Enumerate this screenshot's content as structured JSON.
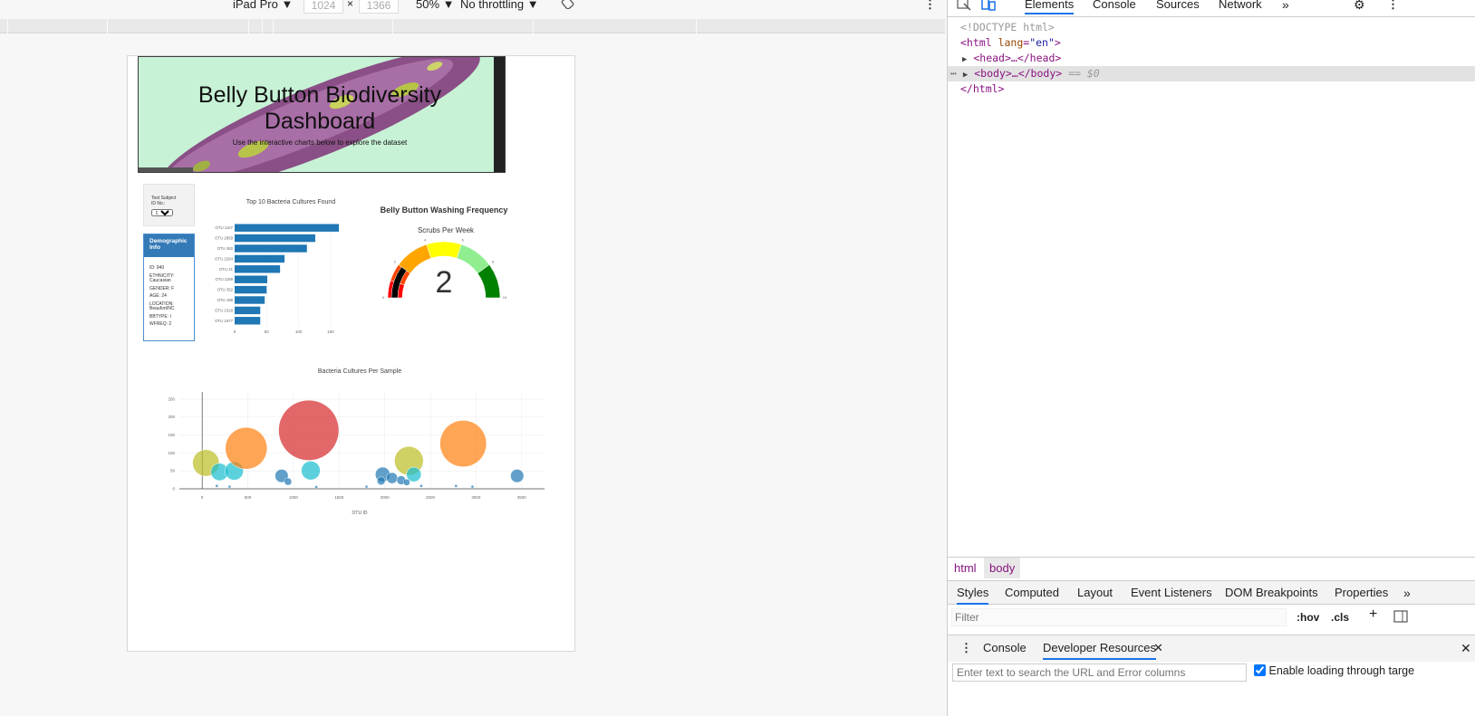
{
  "emulation_toolbar": {
    "device": "iPad Pro ▼",
    "width": "1024",
    "times": "×",
    "height": "1366",
    "zoom": "50% ▼",
    "throttling": "No throttling ▼"
  },
  "dashboard": {
    "title_line1": "Belly Button Biodiversity",
    "title_line2": "Dashboard",
    "subtitle": "Use the interactive charts below to explore the dataset",
    "select_label_1": "Test Subject",
    "select_label_2": "ID No.:",
    "select_value": "940",
    "demo_header": "Demographic Info",
    "demo": {
      "id": "ID: 940",
      "ethnicity": "ETHNICITY: Caucasian",
      "gender": "GENDER: F",
      "age": "AGE: 24",
      "location": "LOCATION: Beaufort/NC",
      "bbtype": "BBTYPE: I",
      "wfreq": "WFREQ: 2"
    }
  },
  "chart_data": [
    {
      "type": "bar",
      "orientation": "horizontal",
      "title": "Top 10 Bacteria Cultures Found",
      "categories": [
        "OTU 1167",
        "OTU 2859",
        "OTU 482",
        "OTU 2264",
        "OTU 41",
        "OTU 1189",
        "OTU 352",
        "OTU 189",
        "OTU 2318",
        "OTU 1977"
      ],
      "values": [
        163,
        126,
        113,
        78,
        71,
        51,
        50,
        47,
        40,
        40
      ],
      "xticks": [
        "0",
        "50",
        "100",
        "150"
      ],
      "xlim": [
        0,
        170
      ]
    },
    {
      "type": "gauge",
      "title": "Belly Button Washing Frequency",
      "subtitle": "Scrubs Per Week",
      "value": 2,
      "value_label": "2",
      "range": [
        0,
        10
      ],
      "tick_labels": [
        "0",
        "2",
        "4",
        "6",
        "8",
        "10"
      ],
      "bands": [
        {
          "from": 0,
          "to": 1,
          "color": "#ff0000"
        },
        {
          "from": 1,
          "to": 2,
          "color": "#ff4500"
        },
        {
          "from": 2,
          "to": 4,
          "color": "#ffa500"
        },
        {
          "from": 4,
          "to": 6,
          "color": "#ffff00"
        },
        {
          "from": 6,
          "to": 8,
          "color": "#90ee90"
        },
        {
          "from": 8,
          "to": 10,
          "color": "#008000"
        }
      ],
      "bar_color": "#000000"
    },
    {
      "type": "scatter",
      "title": "Bacteria Cultures Per Sample",
      "xlabel": "OTU ID",
      "xticks": [
        "0",
        "500",
        "1000",
        "1500",
        "2000",
        "2500",
        "3000",
        "3500"
      ],
      "yticks": [
        "0",
        "50",
        "100",
        "150",
        "200",
        "250"
      ],
      "xlim": [
        -250,
        3750
      ],
      "ylim": [
        0,
        270
      ],
      "points": [
        {
          "x": 40,
          "y": 72,
          "size": 72,
          "color": "#bcbd22"
        },
        {
          "x": 190,
          "y": 47,
          "size": 47,
          "color": "#17becf"
        },
        {
          "x": 350,
          "y": 50,
          "size": 50,
          "color": "#17becf"
        },
        {
          "x": 482,
          "y": 113,
          "size": 113,
          "color": "#ff7f0e"
        },
        {
          "x": 870,
          "y": 36,
          "size": 36,
          "color": "#1f77b4"
        },
        {
          "x": 940,
          "y": 20,
          "size": 20,
          "color": "#1f77b4"
        },
        {
          "x": 1167,
          "y": 163,
          "size": 163,
          "color": "#d62728"
        },
        {
          "x": 1189,
          "y": 51,
          "size": 51,
          "color": "#17becf"
        },
        {
          "x": 1977,
          "y": 40,
          "size": 40,
          "color": "#1f77b4"
        },
        {
          "x": 1960,
          "y": 22,
          "size": 22,
          "color": "#1f77b4"
        },
        {
          "x": 2080,
          "y": 30,
          "size": 30,
          "color": "#1f77b4"
        },
        {
          "x": 2180,
          "y": 24,
          "size": 24,
          "color": "#1f77b4"
        },
        {
          "x": 2264,
          "y": 78,
          "size": 78,
          "color": "#bcbd22"
        },
        {
          "x": 2318,
          "y": 40,
          "size": 40,
          "color": "#17becf"
        },
        {
          "x": 2240,
          "y": 18,
          "size": 18,
          "color": "#1f77b4"
        },
        {
          "x": 2859,
          "y": 126,
          "size": 126,
          "color": "#ff7f0e"
        },
        {
          "x": 3450,
          "y": 36,
          "size": 36,
          "color": "#1f77b4"
        },
        {
          "x": 160,
          "y": 8,
          "size": 8,
          "color": "#1f77b4"
        },
        {
          "x": 300,
          "y": 6,
          "size": 6,
          "color": "#1f77b4"
        },
        {
          "x": 1250,
          "y": 5,
          "size": 5,
          "color": "#1f77b4"
        },
        {
          "x": 1800,
          "y": 6,
          "size": 6,
          "color": "#1f77b4"
        },
        {
          "x": 2400,
          "y": 8,
          "size": 8,
          "color": "#1f77b4"
        },
        {
          "x": 2780,
          "y": 8,
          "size": 8,
          "color": "#1f77b4"
        },
        {
          "x": 2960,
          "y": 6,
          "size": 6,
          "color": "#1f77b4"
        }
      ]
    }
  ],
  "devtools": {
    "tabs": [
      "Elements",
      "Console",
      "Sources",
      "Network",
      "»"
    ],
    "code": {
      "doctype": "<!DOCTYPE html>",
      "html_open": "<html",
      "lang_attr": "lang",
      "lang_val": "\"en\"",
      "html_gt": ">",
      "head": "<head>…</head>",
      "body": "<body>…</body>",
      "sel": "== $0",
      "html_close": "</html>"
    },
    "breadcrumbs": [
      "html",
      "body"
    ],
    "subtabs": [
      "Styles",
      "Computed",
      "Layout",
      "Event Listeners",
      "DOM Breakpoints",
      "Properties",
      "»"
    ],
    "filter_placeholder": "Filter",
    "hov": ":hov",
    "cls": ".cls",
    "drawer_tabs": [
      "Console",
      "Developer Resources"
    ],
    "search_placeholder": "Enter text to search the URL and Error columns",
    "enable_loading": "Enable loading through targe"
  },
  "colors": {
    "accent": "#1a73e8",
    "bar": "#1f77b4",
    "tag": "#881280"
  }
}
